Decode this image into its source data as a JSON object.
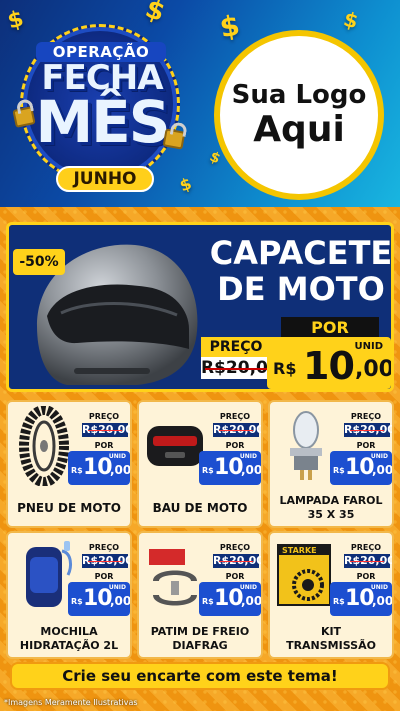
{
  "header": {
    "badge_top": "OPERAÇÃO",
    "badge_line1": "FECHA",
    "badge_line2": "MÊS",
    "badge_sub": "JUNHO",
    "logo_line1": "Sua Logo",
    "logo_line2": "Aqui",
    "dollar_symbol": "$"
  },
  "main_offer": {
    "discount": "-50%",
    "title_line1": "CAPACETE",
    "title_line2": "DE MOTO",
    "por_label": "POR",
    "preco_label": "PREÇO",
    "old_price": "R$20,00",
    "currency": "R$",
    "price_int": "10",
    "price_cents": ",00",
    "unit": "UNID",
    "image_icon": "helmet-icon"
  },
  "products": [
    {
      "name_line1": "PNEU DE MOTO",
      "name_line2": "",
      "preco_label": "PREÇO",
      "old_price": "R$20,00",
      "por_label": "POR",
      "currency": "R$",
      "price_int": "10",
      "price_cents": ",00",
      "unit": "UNID",
      "image_icon": "tire-icon"
    },
    {
      "name_line1": "BAU DE MOTO",
      "name_line2": "",
      "preco_label": "PREÇO",
      "old_price": "R$20,00",
      "por_label": "POR",
      "currency": "R$",
      "price_int": "10",
      "price_cents": ",00",
      "unit": "UNID",
      "image_icon": "top-case-icon"
    },
    {
      "name_line1": "LAMPADA FAROL",
      "name_line2": "35 X 35",
      "preco_label": "PREÇO",
      "old_price": "R$20,00",
      "por_label": "POR",
      "currency": "R$",
      "price_int": "10",
      "price_cents": ",00",
      "unit": "UNID",
      "image_icon": "headlight-bulb-icon"
    },
    {
      "name_line1": "MOCHILA",
      "name_line2": "HIDRATAÇÃO 2L",
      "preco_label": "PREÇO",
      "old_price": "R$20,00",
      "por_label": "POR",
      "currency": "R$",
      "price_int": "10",
      "price_cents": ",00",
      "unit": "UNID",
      "image_icon": "backpack-icon"
    },
    {
      "name_line1": "PATIM DE FREIO",
      "name_line2": "DIAFRAG",
      "preco_label": "PREÇO",
      "old_price": "R$20,00",
      "por_label": "POR",
      "currency": "R$",
      "price_int": "10",
      "price_cents": ",00",
      "unit": "UNID",
      "image_icon": "brake-shoe-icon"
    },
    {
      "name_line1": "KIT",
      "name_line2": "TRANSMISSÃO",
      "preco_label": "PREÇO",
      "old_price": "R$20,00",
      "por_label": "POR",
      "currency": "R$",
      "price_int": "10",
      "price_cents": ",00",
      "unit": "UNID",
      "image_icon": "transmission-kit-icon",
      "brand": "STARKE"
    }
  ],
  "cta": "Crie seu encarte com este tema!",
  "disclaimer": "*Imagens Meramente Ilustrativas",
  "colors": {
    "navy": "#0f2f78",
    "yellow": "#ffd21a",
    "orange": "#f39a1a",
    "price_blue": "#1c4fd0"
  }
}
